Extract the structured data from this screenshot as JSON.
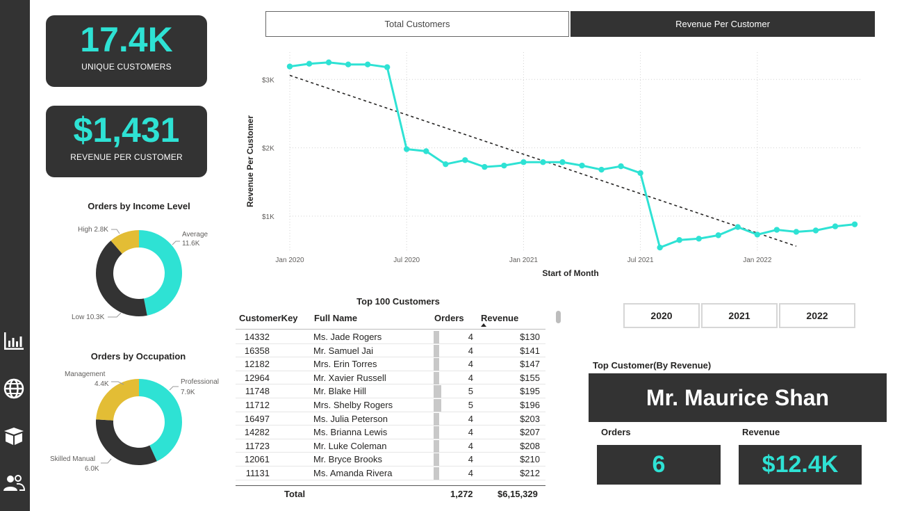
{
  "kpis": {
    "unique_customers": {
      "value": "17.4K",
      "label": "UNIQUE CUSTOMERS"
    },
    "revenue_per_customer": {
      "value": "$1,431",
      "label": "REVENUE PER CUSTOMER"
    }
  },
  "income_chart": {
    "title": "Orders by Income Level",
    "slices": [
      {
        "name": "Average",
        "value": "11.6K",
        "num": 11600,
        "color": "#2ee2d4"
      },
      {
        "name": "Low",
        "value": "10.3K",
        "num": 10300,
        "color": "#333333"
      },
      {
        "name": "High",
        "value": "2.8K",
        "num": 2800,
        "color": "#e3bd35"
      }
    ]
  },
  "occupation_chart": {
    "title": "Orders by Occupation",
    "slices": [
      {
        "name": "Professional",
        "value": "7.9K",
        "num": 7900,
        "color": "#2ee2d4"
      },
      {
        "name": "Skilled Manual",
        "value": "6.0K",
        "num": 6000,
        "color": "#333333"
      },
      {
        "name": "Management",
        "value": "4.4K",
        "num": 4400,
        "color": "#e3bd35"
      }
    ]
  },
  "tabs": {
    "total_customers": "Total Customers",
    "revenue_per_customer": "Revenue Per Customer"
  },
  "chart_data": {
    "type": "line",
    "xlabel": "Start of Month",
    "ylabel": "Revenue Per Customer",
    "x_ticks": [
      "Jan 2020",
      "Jul 2020",
      "Jan 2021",
      "Jul 2021",
      "Jan 2022"
    ],
    "y_ticks": [
      "$1K",
      "$2K",
      "$3K"
    ],
    "ylim": [
      500,
      3400
    ],
    "series": [
      {
        "color": "#2ee2d4",
        "x": [
          "2020-01",
          "2020-02",
          "2020-03",
          "2020-04",
          "2020-05",
          "2020-06",
          "2020-07",
          "2020-08",
          "2020-09",
          "2020-10",
          "2020-11",
          "2020-12",
          "2021-01",
          "2021-02",
          "2021-03",
          "2021-04",
          "2021-05",
          "2021-06",
          "2021-07",
          "2021-08",
          "2021-09",
          "2021-10",
          "2021-11",
          "2021-12",
          "2022-01",
          "2022-02",
          "2022-03",
          "2022-04",
          "2022-05",
          "2022-06"
        ],
        "values": [
          3190,
          3230,
          3250,
          3220,
          3220,
          3180,
          1980,
          1950,
          1760,
          1820,
          1720,
          1740,
          1790,
          1790,
          1790,
          1740,
          1680,
          1730,
          1630,
          540,
          650,
          670,
          720,
          840,
          730,
          800,
          770,
          790,
          850,
          880
        ]
      }
    ],
    "trendline": {
      "style": "dashed",
      "color": "#252423",
      "start": 3060,
      "end": 560
    },
    "grid": true
  },
  "table": {
    "title": "Top 100 Customers",
    "headers": {
      "key": "CustomerKey",
      "name": "Full Name",
      "orders": "Orders",
      "revenue": "Revenue"
    },
    "rows": [
      {
        "key": "14332",
        "name": "Ms. Jade Rogers",
        "orders": "4",
        "revenue": "$130"
      },
      {
        "key": "16358",
        "name": "Mr. Samuel Jai",
        "orders": "4",
        "revenue": "$141"
      },
      {
        "key": "12182",
        "name": "Mrs. Erin Torres",
        "orders": "4",
        "revenue": "$147"
      },
      {
        "key": "12964",
        "name": "Mr. Xavier Russell",
        "orders": "4",
        "revenue": "$155"
      },
      {
        "key": "11748",
        "name": "Mr. Blake Hill",
        "orders": "5",
        "revenue": "$195"
      },
      {
        "key": "11712",
        "name": "Mrs. Shelby Rogers",
        "orders": "5",
        "revenue": "$196"
      },
      {
        "key": "16497",
        "name": "Ms. Julia Peterson",
        "orders": "4",
        "revenue": "$203"
      },
      {
        "key": "14282",
        "name": "Ms. Brianna Lewis",
        "orders": "4",
        "revenue": "$207"
      },
      {
        "key": "11723",
        "name": "Mr. Luke Coleman",
        "orders": "4",
        "revenue": "$208"
      },
      {
        "key": "12061",
        "name": "Mr. Bryce Brooks",
        "orders": "4",
        "revenue": "$210"
      },
      {
        "key": "11131",
        "name": "Ms. Amanda Rivera",
        "orders": "4",
        "revenue": "$212"
      }
    ],
    "total": {
      "label": "Total",
      "orders": "1,272",
      "revenue": "$6,15,329"
    }
  },
  "years": [
    "2020",
    "2021",
    "2022"
  ],
  "top_customer": {
    "title": "Top Customer(By Revenue)",
    "name": "Mr. Maurice Shan",
    "orders_label": "Orders",
    "orders_value": "6",
    "revenue_label": "Revenue",
    "revenue_value": "$12.4K"
  },
  "nav_icons": [
    "bar-chart-icon",
    "globe-icon",
    "box-icon",
    "users-icon"
  ]
}
